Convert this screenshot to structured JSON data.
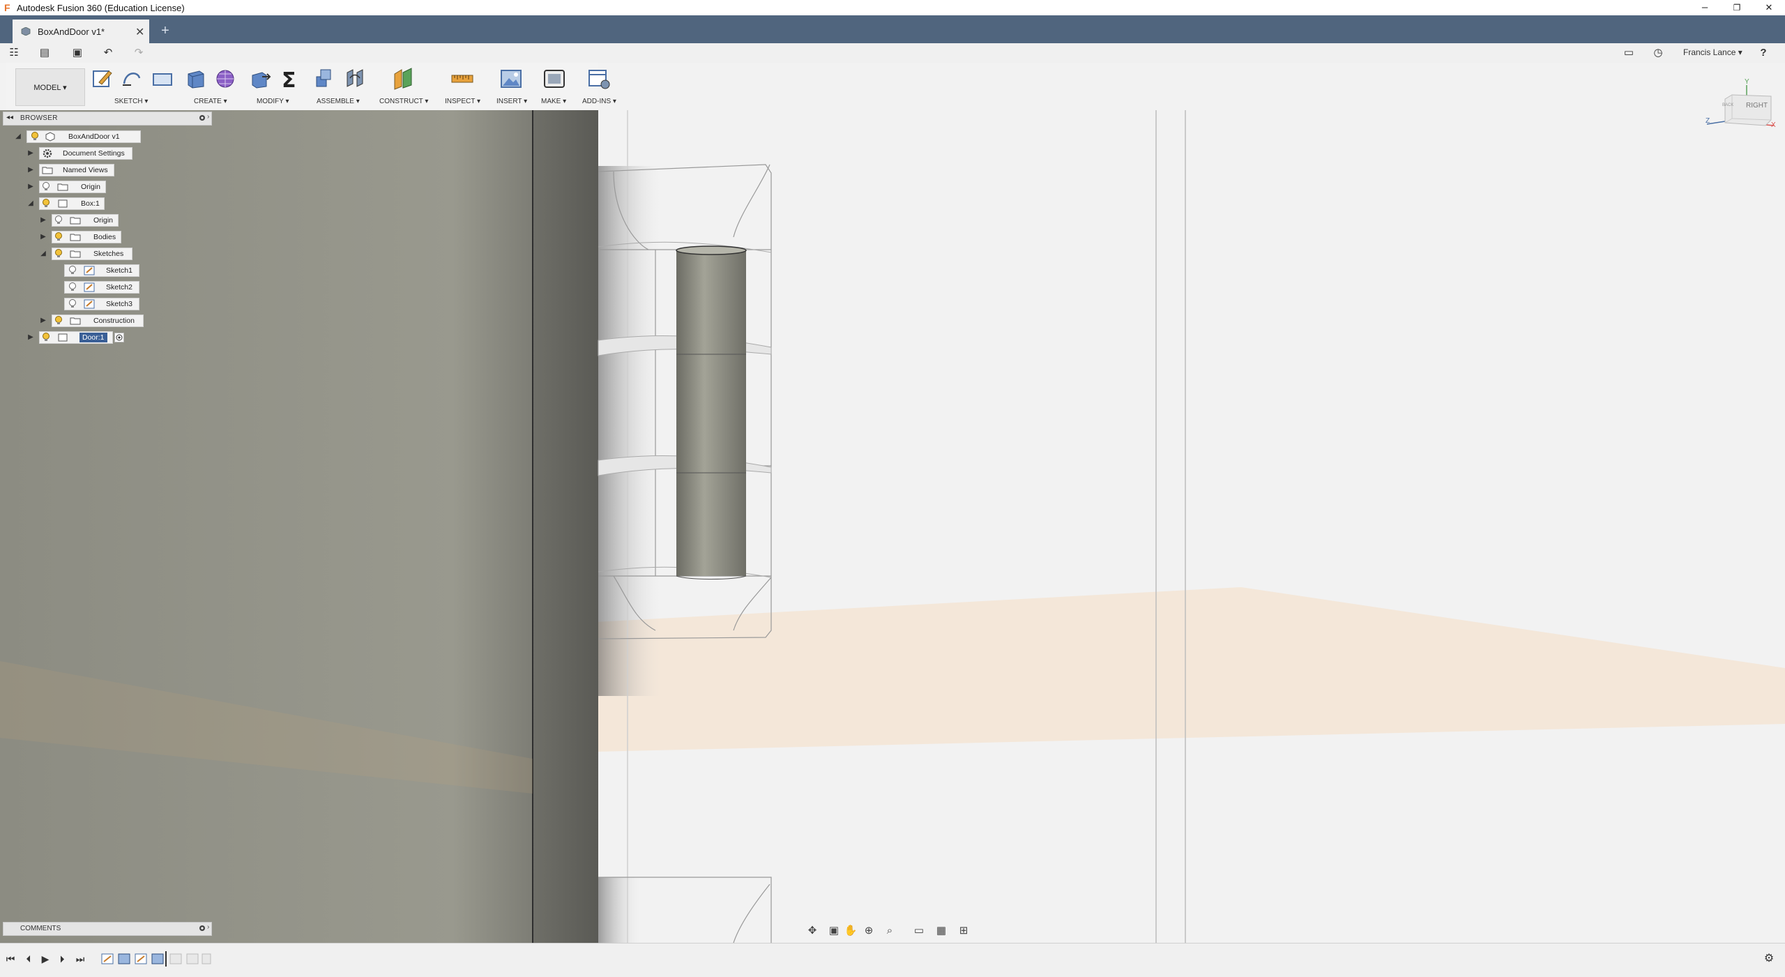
{
  "window": {
    "title": "Autodesk Fusion 360 (Education License)",
    "minimize": "–",
    "restore": "❐",
    "close": "✕"
  },
  "tabs": {
    "active_label": "BoxAndDoor v1*",
    "close": "✕",
    "new": "+"
  },
  "quick_access": {
    "data_panel": "☷",
    "file": "▤",
    "save": "▣",
    "undo": "↶",
    "redo": "↷",
    "notifications": "▭",
    "history": "◷",
    "user": "Francis Lance ▾",
    "help": "?"
  },
  "ribbon": {
    "workspace": "MODEL ▾",
    "groups": [
      "SKETCH ▾",
      "CREATE ▾",
      "MODIFY ▾",
      "ASSEMBLE ▾",
      "CONSTRUCT ▾",
      "INSPECT ▾",
      "INSERT ▾",
      "MAKE ▾",
      "ADD-INS ▾"
    ]
  },
  "browser": {
    "title": "BROWSER",
    "nodes": [
      {
        "label": "BoxAndDoor v1"
      },
      {
        "label": "Document Settings"
      },
      {
        "label": "Named Views"
      },
      {
        "label": "Origin"
      },
      {
        "label": "Box:1"
      },
      {
        "label": "Origin"
      },
      {
        "label": "Bodies"
      },
      {
        "label": "Sketches"
      },
      {
        "label": "Sketch1"
      },
      {
        "label": "Sketch2"
      },
      {
        "label": "Sketch3"
      },
      {
        "label": "Construction"
      },
      {
        "label": "Door:1"
      }
    ]
  },
  "viewcube": {
    "face_right": "RIGHT",
    "face_back": "BACK",
    "axis_x": "X",
    "axis_y": "Y",
    "axis_z": "Z"
  },
  "comments": {
    "title": "COMMENTS"
  },
  "timeline": {
    "first": "⏮",
    "prev": "⏴",
    "play": "▶",
    "next": "⏵",
    "last": "⏭",
    "settings": "⚙"
  },
  "colors": {
    "titlebar": "#ffffff",
    "tabbar": "#50657e",
    "panel": "#f0f0f0",
    "door_face": "#8f8f85",
    "viewport_bg": "#f1f1f1",
    "ground_plane": "#f3e5d6"
  }
}
